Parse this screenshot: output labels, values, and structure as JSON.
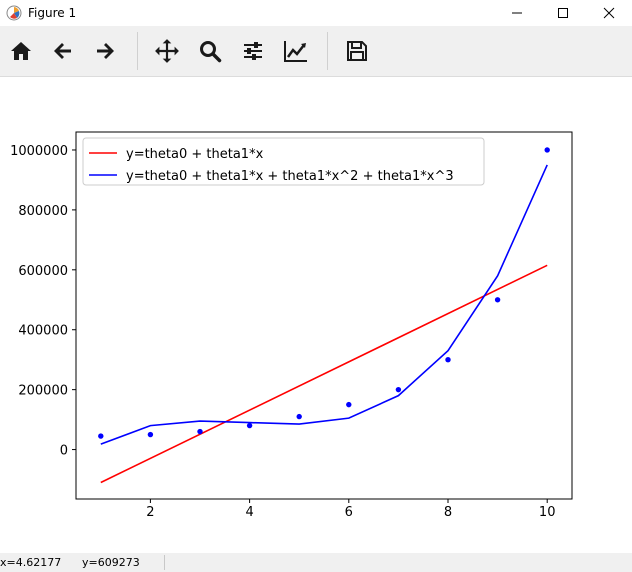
{
  "window": {
    "title": "Figure 1"
  },
  "toolbar": {
    "buttons": [
      "home-icon",
      "back-arrow-icon",
      "forward-arrow-icon",
      "pan-icon",
      "zoom-icon",
      "configure-subplots-icon",
      "edit-axis-icon",
      "save-icon"
    ]
  },
  "status": {
    "x": "x=4.62177",
    "y": "y=609273"
  },
  "chart_data": {
    "type": "line",
    "xlim": [
      0.5,
      10.5
    ],
    "ylim": [
      -165000,
      1060000
    ],
    "x_ticks": [
      2,
      4,
      6,
      8,
      10
    ],
    "y_ticks": [
      0,
      200000,
      400000,
      600000,
      800000,
      1000000
    ],
    "x_tick_labels": [
      "2",
      "4",
      "6",
      "8",
      "10"
    ],
    "y_tick_labels": [
      "0",
      "200000",
      "400000",
      "600000",
      "800000",
      "1000000"
    ],
    "legend_position": "upper-left",
    "points": {
      "x": [
        1,
        2,
        3,
        4,
        5,
        6,
        7,
        8,
        9,
        10
      ],
      "y": [
        45000,
        50000,
        60000,
        80000,
        110000,
        150000,
        200000,
        300000,
        500000,
        1000000
      ],
      "color": "#0000ff"
    },
    "series": [
      {
        "name": "y=theta0 + theta1*x",
        "color": "#ff0000",
        "x": [
          1,
          10
        ],
        "y": [
          -110000,
          615000
        ]
      },
      {
        "name": "y=theta0 + theta1*x + theta1*x^2 + theta1*x^3",
        "color": "#0000ff",
        "x": [
          1,
          2,
          3,
          4,
          5,
          6,
          7,
          8,
          9,
          10
        ],
        "y": [
          18000,
          80000,
          95000,
          90000,
          85000,
          105000,
          180000,
          330000,
          580000,
          950000
        ]
      }
    ]
  }
}
